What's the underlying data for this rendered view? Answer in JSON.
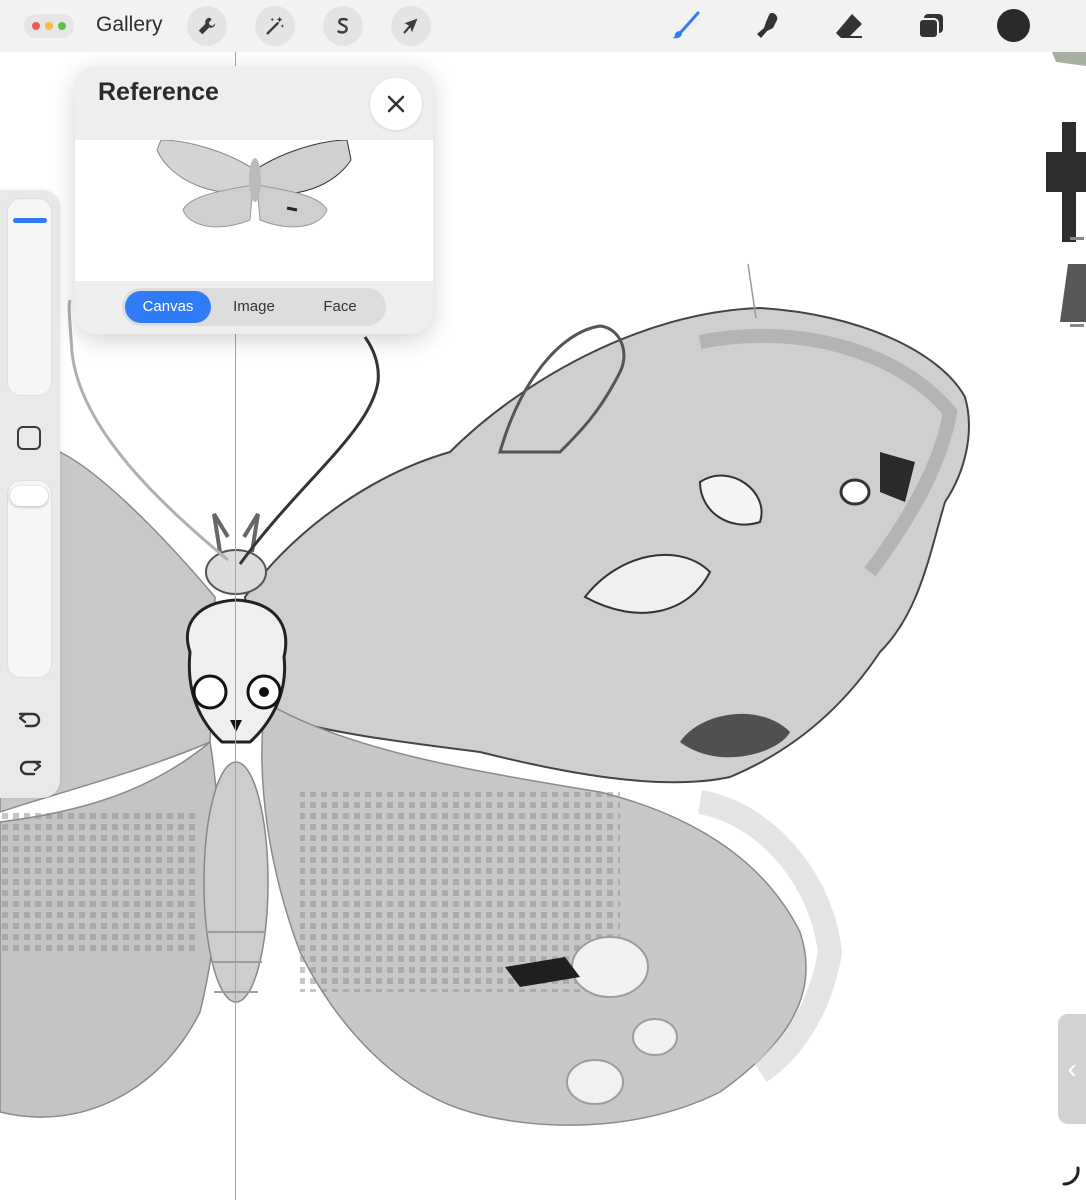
{
  "app": {
    "gallery_label": "Gallery"
  },
  "toolbar": {
    "left_tools": [
      {
        "name": "actions",
        "icon": "wrench-icon"
      },
      {
        "name": "adjustments",
        "icon": "magic-wand-icon"
      },
      {
        "name": "selection",
        "icon": "selection-s-icon"
      },
      {
        "name": "transform",
        "icon": "arrow-cursor-icon"
      }
    ],
    "right_tools": [
      {
        "name": "brush",
        "icon": "brush-icon",
        "active": true
      },
      {
        "name": "smudge",
        "icon": "smudge-finger-icon"
      },
      {
        "name": "eraser",
        "icon": "eraser-icon"
      },
      {
        "name": "layers",
        "icon": "layers-icon"
      }
    ],
    "current_color": "#2a2a2a",
    "accent_color": "#2f7cf6"
  },
  "reference": {
    "title": "Reference",
    "tabs": [
      {
        "label": "Canvas",
        "active": true
      },
      {
        "label": "Image",
        "active": false
      },
      {
        "label": "Face",
        "active": false
      }
    ]
  },
  "sidebar": {
    "brush_size_level": 0.92,
    "opacity_level": 1.0
  }
}
